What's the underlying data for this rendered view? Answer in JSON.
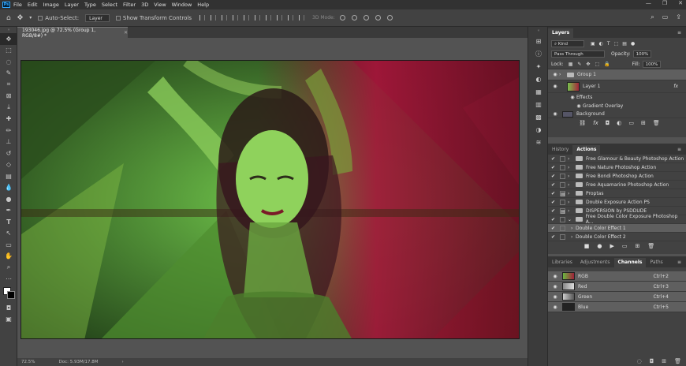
{
  "app": {
    "logo": "Ps"
  },
  "menu": [
    "File",
    "Edit",
    "Image",
    "Layer",
    "Type",
    "Select",
    "Filter",
    "3D",
    "View",
    "Window",
    "Help"
  ],
  "window_controls": [
    "—",
    "❐",
    "✕"
  ],
  "options": {
    "auto_select_label": "Auto-Select:",
    "auto_select_value": "Layer",
    "transform_label": "Show Transform Controls",
    "mode_3d": "3D Mode:"
  },
  "document": {
    "tab_title": "193046.jpg @ 72.5% (Group 1, RGB/8#) *",
    "zoom": "72.5%",
    "doc_size": "Doc: 5.93M/17.8M"
  },
  "layers_panel": {
    "tab": "Layers",
    "filter_kind": "Kind",
    "blend_mode": "Pass Through",
    "opacity_label": "Opacity:",
    "opacity_value": "100%",
    "lock_label": "Lock:",
    "fill_label": "Fill:",
    "fill_value": "100%",
    "rows": [
      {
        "name": "Group 1",
        "kind": "group"
      },
      {
        "name": "Layer 1",
        "kind": "layer",
        "fx": "fx"
      },
      {
        "name": "Effects",
        "kind": "effects"
      },
      {
        "name": "Gradient Overlay",
        "kind": "effect"
      },
      {
        "name": "Background",
        "kind": "layer"
      }
    ]
  },
  "actions_panel": {
    "tabs": [
      "History",
      "Actions"
    ],
    "items": [
      {
        "name": "Free Glamour & Beauty Photoshop Action",
        "folder": true
      },
      {
        "name": "Free Nature Photoshop Action",
        "folder": true
      },
      {
        "name": "Free Bondi Photoshop Action",
        "folder": true
      },
      {
        "name": "Free Aquamarine Photoshop Action",
        "folder": true
      },
      {
        "name": "Proptas",
        "folder": true
      },
      {
        "name": "Double Exposure Action PS",
        "folder": true
      },
      {
        "name": "DISPERSION by PSDDUDE",
        "folder": true
      },
      {
        "name": "Free Double Color Exposure Photoshop A...",
        "folder": true
      },
      {
        "name": "Double Color Effect 1",
        "folder": false
      },
      {
        "name": "Double Color Effect 2",
        "folder": false
      }
    ]
  },
  "channels_panel": {
    "tabs": [
      "Libraries",
      "Adjustments",
      "Channels",
      "Paths"
    ],
    "rows": [
      {
        "name": "RGB",
        "shortcut": "Ctrl+2"
      },
      {
        "name": "Red",
        "shortcut": "Ctrl+3"
      },
      {
        "name": "Green",
        "shortcut": "Ctrl+4"
      },
      {
        "name": "Blue",
        "shortcut": "Ctrl+5"
      }
    ]
  },
  "colors": {
    "accent": "#31a8ff",
    "selected_row": "#5f5f5f",
    "panel": "#424242"
  }
}
